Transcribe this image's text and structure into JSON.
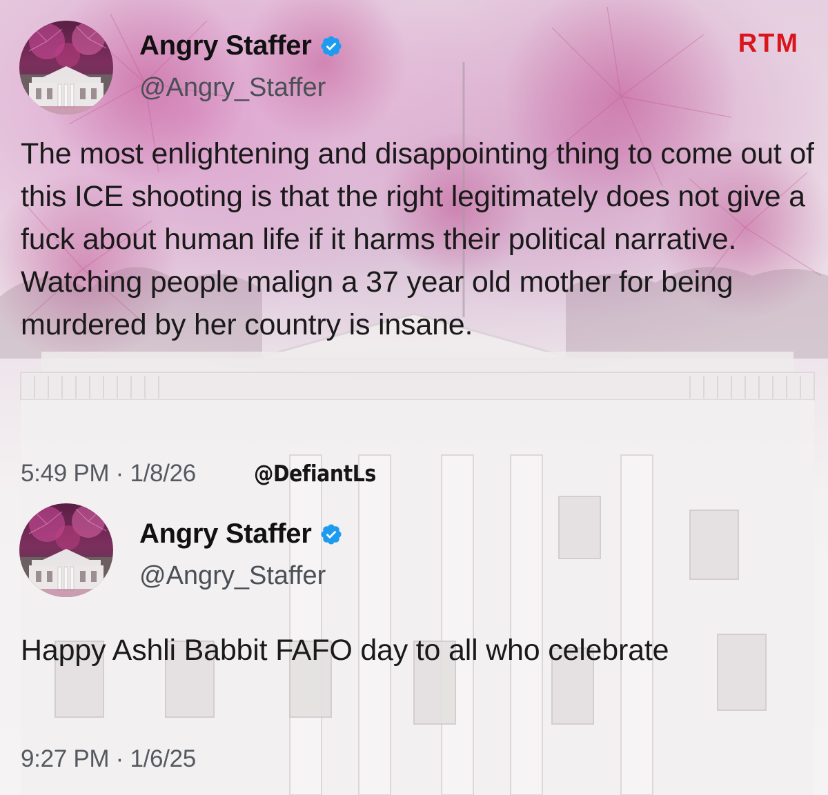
{
  "brand": {
    "label": "RTM",
    "color": "#d8161b"
  },
  "watermark": "@DefiantLs",
  "tweets": [
    {
      "name": "Angry Staffer",
      "handle": "@Angry_Staffer",
      "verified_icon": "verified-badge-icon",
      "text": "The most enlightening and disappointing thing to come out of this ICE shooting is that the right legitimately does not give a fuck about human life if it harms their political narrative. Watching people malign a 37 year old mother for being murdered by her country is insane.",
      "timestamp": "5:49 PM · 1/8/26"
    },
    {
      "name": "Angry Staffer",
      "handle": "@Angry_Staffer",
      "verified_icon": "verified-badge-icon",
      "text": "Happy Ashli Babbit FAFO day to all who celebrate",
      "timestamp": "9:27 PM · 1/6/25"
    }
  ],
  "colors": {
    "verified": "#1d9bf0",
    "text": "#1a1a1a",
    "secondary_text": "#4a4f55"
  }
}
